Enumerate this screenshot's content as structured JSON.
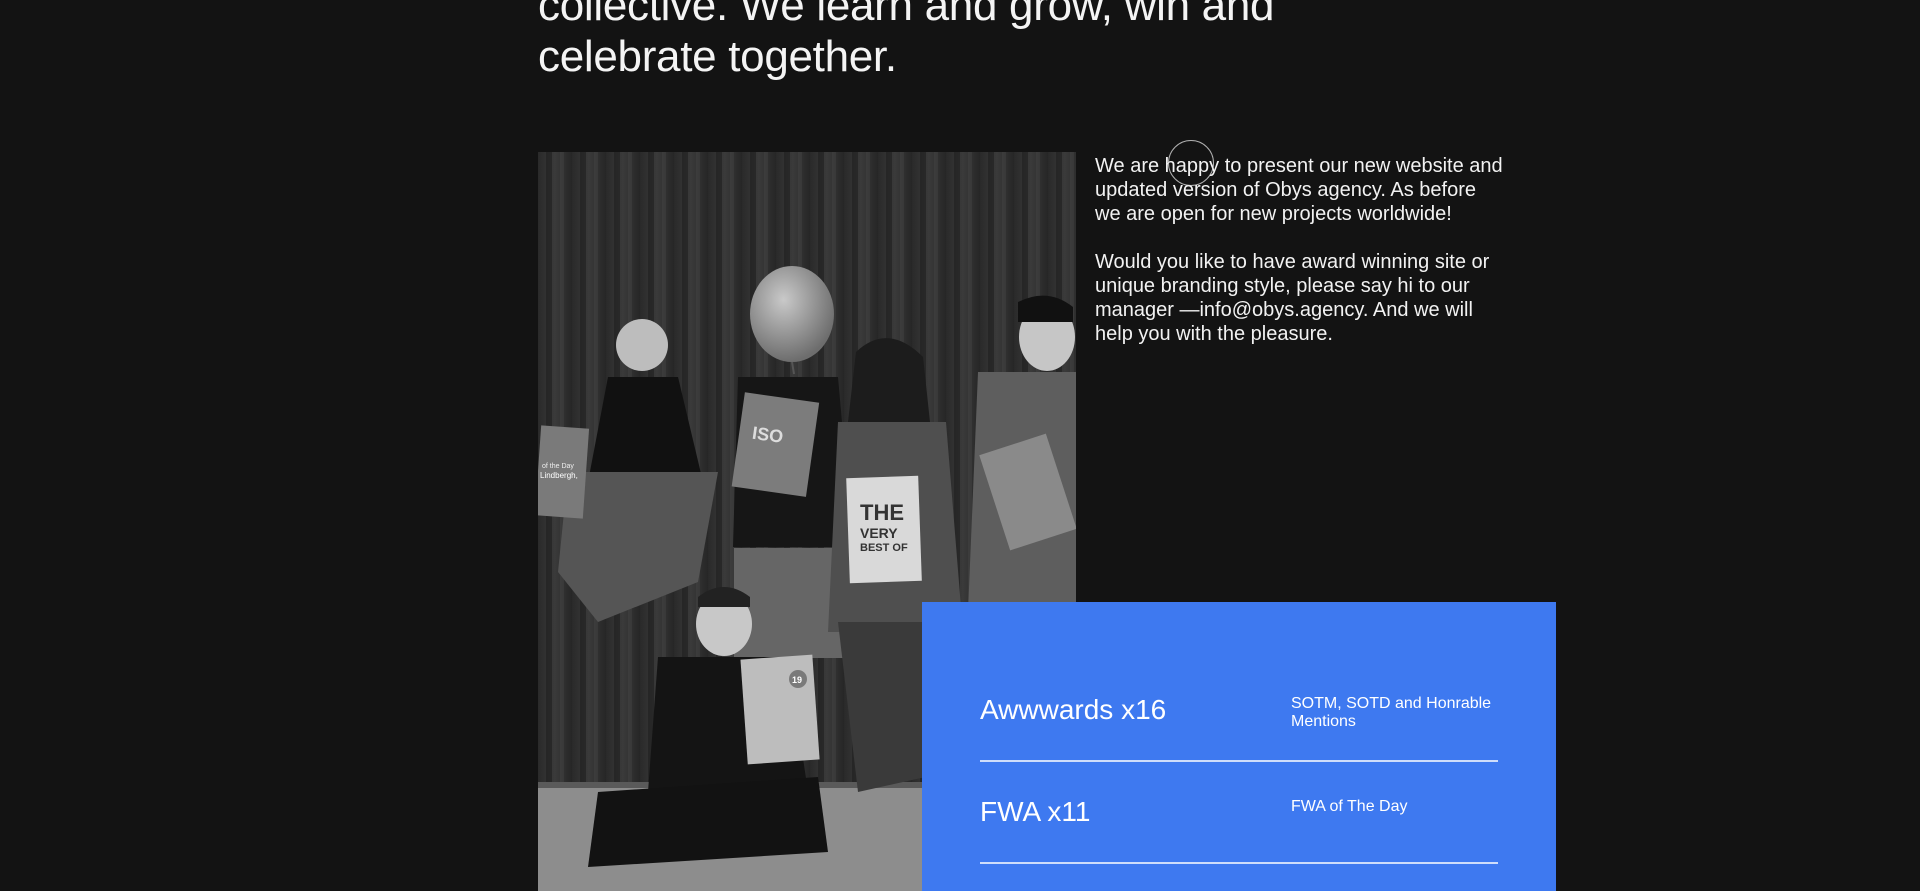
{
  "headline": {
    "line1": "collective. We learn and grow, win and",
    "line2": "celebrate together."
  },
  "intro": {
    "paragraph1": "We are happy to present our new website and updated version of Obys agency. As before we are open for new projects worldwide!",
    "paragraph2": "Would you like to have award winning site or unique branding style, please say hi to our manager —info@obys.agency. And we will help you with the pleasure."
  },
  "photo": {
    "signs": {
      "left_title": "of the Day",
      "left_name": "Lindbergh,",
      "center_title_1": "THE",
      "center_title_2": "VERY",
      "center_title_3": "BEST OF",
      "bottom_badge": "19"
    }
  },
  "awards": [
    {
      "name": "Awwwards x16",
      "description": "SOTM, SOTD and Honrable Mentions"
    },
    {
      "name": "FWA x11",
      "description": "FWA of The Day"
    }
  ],
  "colors": {
    "background": "#131313",
    "awards_card": "#3e79f0",
    "text": "#f2f2f2"
  }
}
